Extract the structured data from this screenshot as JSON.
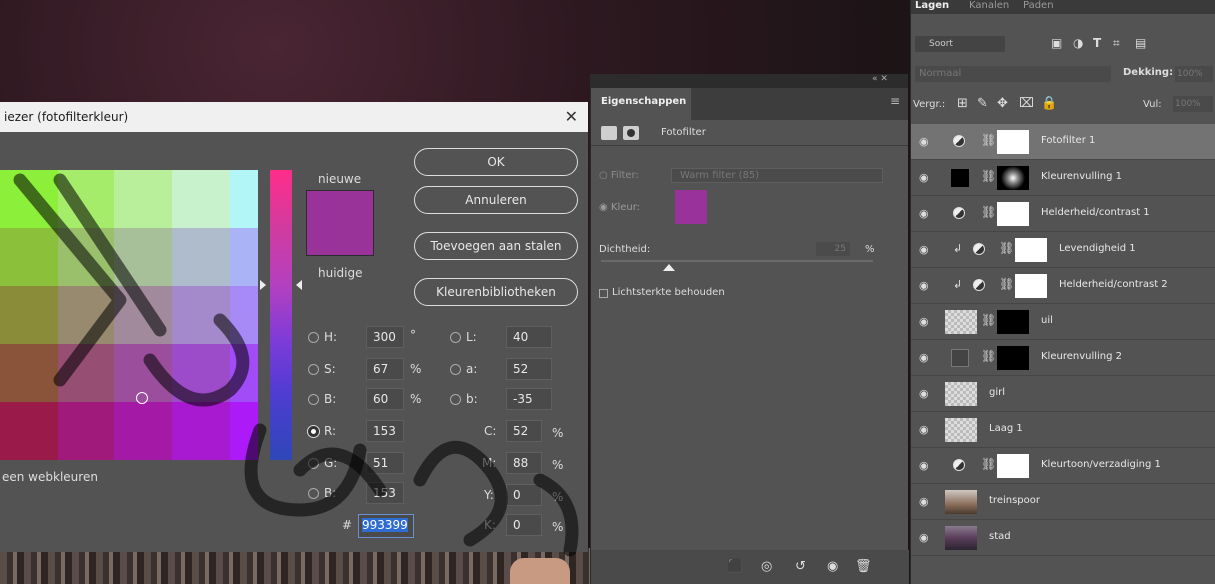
{
  "picker": {
    "title": "iezer (fotofilterkleur)",
    "close": "✕",
    "new_label": "nieuwe",
    "current_label": "huidige",
    "buttons": {
      "ok": "OK",
      "cancel": "Annuleren",
      "add_swatch": "Toevoegen aan stalen",
      "libraries": "Kleurenbibliotheken"
    },
    "fields": {
      "H": "300",
      "H_unit": "°",
      "S": "67",
      "S_unit": "%",
      "B": "60",
      "B_unit": "%",
      "L": "40",
      "a": "52",
      "b": "-35",
      "R": "153",
      "G": "51",
      "B2": "153",
      "C": "52",
      "M": "88",
      "Y": "0",
      "K": "0",
      "cmyk_unit": "%"
    },
    "labels": {
      "H": "H:",
      "S": "S:",
      "B": "B:",
      "L": "L:",
      "a": "a:",
      "b": "b:",
      "R": "R:",
      "G": "G:",
      "B2": "B:",
      "C": "C:",
      "M": "M:",
      "Y": "Y:",
      "K": "K:",
      "hash": "#"
    },
    "hex": "993399",
    "web_only": "een webkleuren",
    "selected_color": "#993399"
  },
  "properties": {
    "tab": "Eigenschappen",
    "menu": "≡",
    "collapse": "«  ✕",
    "title": "Fotofilter",
    "filter_label": "Filter:",
    "filter_value": "Warm filter (85)",
    "color_label": "Kleur:",
    "density_label": "Dichtheid:",
    "density_value": "25",
    "density_unit": "%",
    "density_fraction": 0.25,
    "preserve_luminosity": "Lichtsterkte behouden"
  },
  "layers": {
    "tabs": [
      "Lagen",
      "Kanalen",
      "Paden"
    ],
    "filter_kind": "Soort",
    "blend_mode": "Normaal",
    "opacity_label": "Dekking:",
    "opacity_value": "100%",
    "lock_label": "Vergr.:",
    "fill_label": "Vul:",
    "fill_value": "100%",
    "items": [
      {
        "name": "Fotofilter 1"
      },
      {
        "name": "Kleurenvulling 1"
      },
      {
        "name": "Helderheid/contrast 1"
      },
      {
        "name": "Levendigheid 1"
      },
      {
        "name": "Helderheid/contrast 2"
      },
      {
        "name": "uil"
      },
      {
        "name": "Kleurenvulling 2"
      },
      {
        "name": "girl"
      },
      {
        "name": "Laag 1"
      },
      {
        "name": "Kleurtoon/verzadiging 1"
      },
      {
        "name": "treinspoor"
      },
      {
        "name": "stad"
      }
    ]
  }
}
